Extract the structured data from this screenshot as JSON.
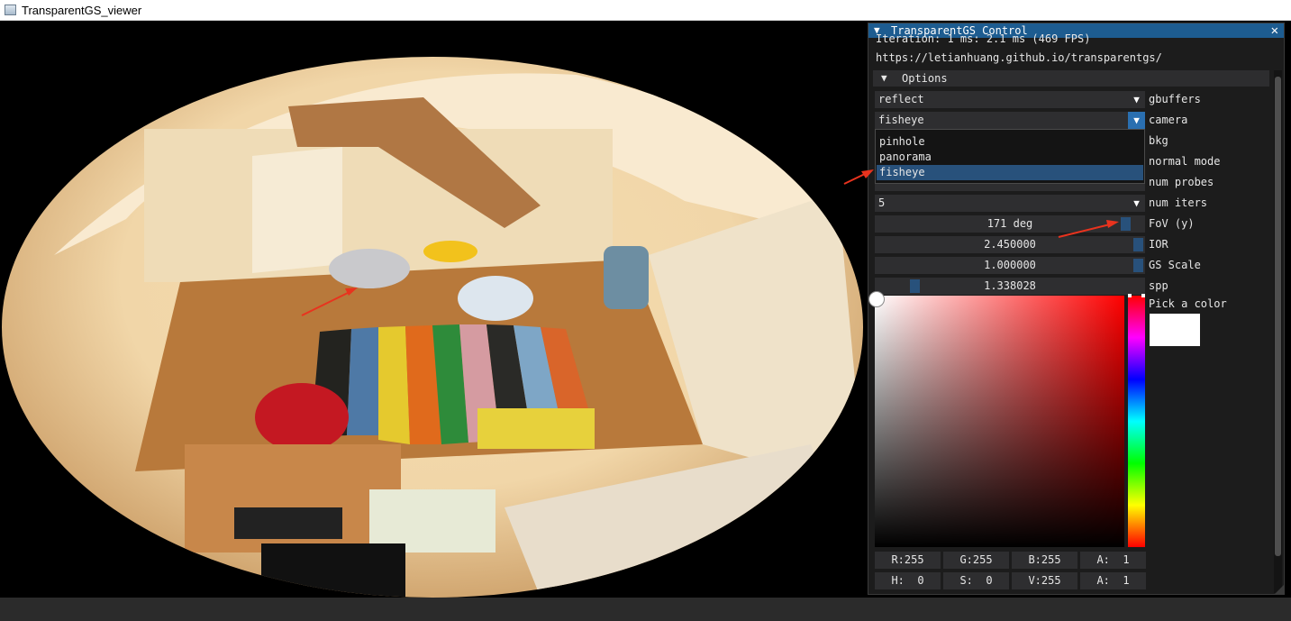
{
  "window": {
    "title": "TransparentGS_viewer"
  },
  "panel": {
    "title": "TransparentGS Control",
    "close_glyph": "✕",
    "info_line": "Iteration: 1  ms: 2.1 ms (469 FPS)",
    "url": "https://letianhuang.github.io/transparentgs/",
    "options_header": "Options",
    "gbuffers": {
      "value": "reflect",
      "label": "gbuffers"
    },
    "camera": {
      "value": "fisheye",
      "label": "camera",
      "options": [
        "pinhole",
        "panorama",
        "fisheye"
      ],
      "selected_index": 2
    },
    "bkg_label": "bkg",
    "normal_mode_label": "normal mode",
    "num_probes_label": "num probes",
    "num_iters": {
      "value": "5",
      "label": "num iters"
    },
    "fov": {
      "value": "171 deg",
      "label": "FoV (y)",
      "fraction": 0.95
    },
    "ior": {
      "value": "2.450000",
      "label": "IOR",
      "fraction": 1.0
    },
    "gs_scale": {
      "value": "1.000000",
      "label": "GS Scale",
      "fraction": 1.0
    },
    "spp": {
      "value": "1.338028",
      "label": "spp",
      "fraction": 0.13
    },
    "color_picker": {
      "label": "Pick a color",
      "color": "#ffffff",
      "rgb_fields": [
        "R:255",
        "G:255",
        "B:255",
        "A:  1"
      ],
      "hsv_fields": [
        "H:  0",
        "S:  0",
        "V:255",
        "A:  1"
      ]
    }
  },
  "colors": {
    "accent": "#1d5c90",
    "selection": "#28517b",
    "annotation_arrow": "#e8331e"
  }
}
